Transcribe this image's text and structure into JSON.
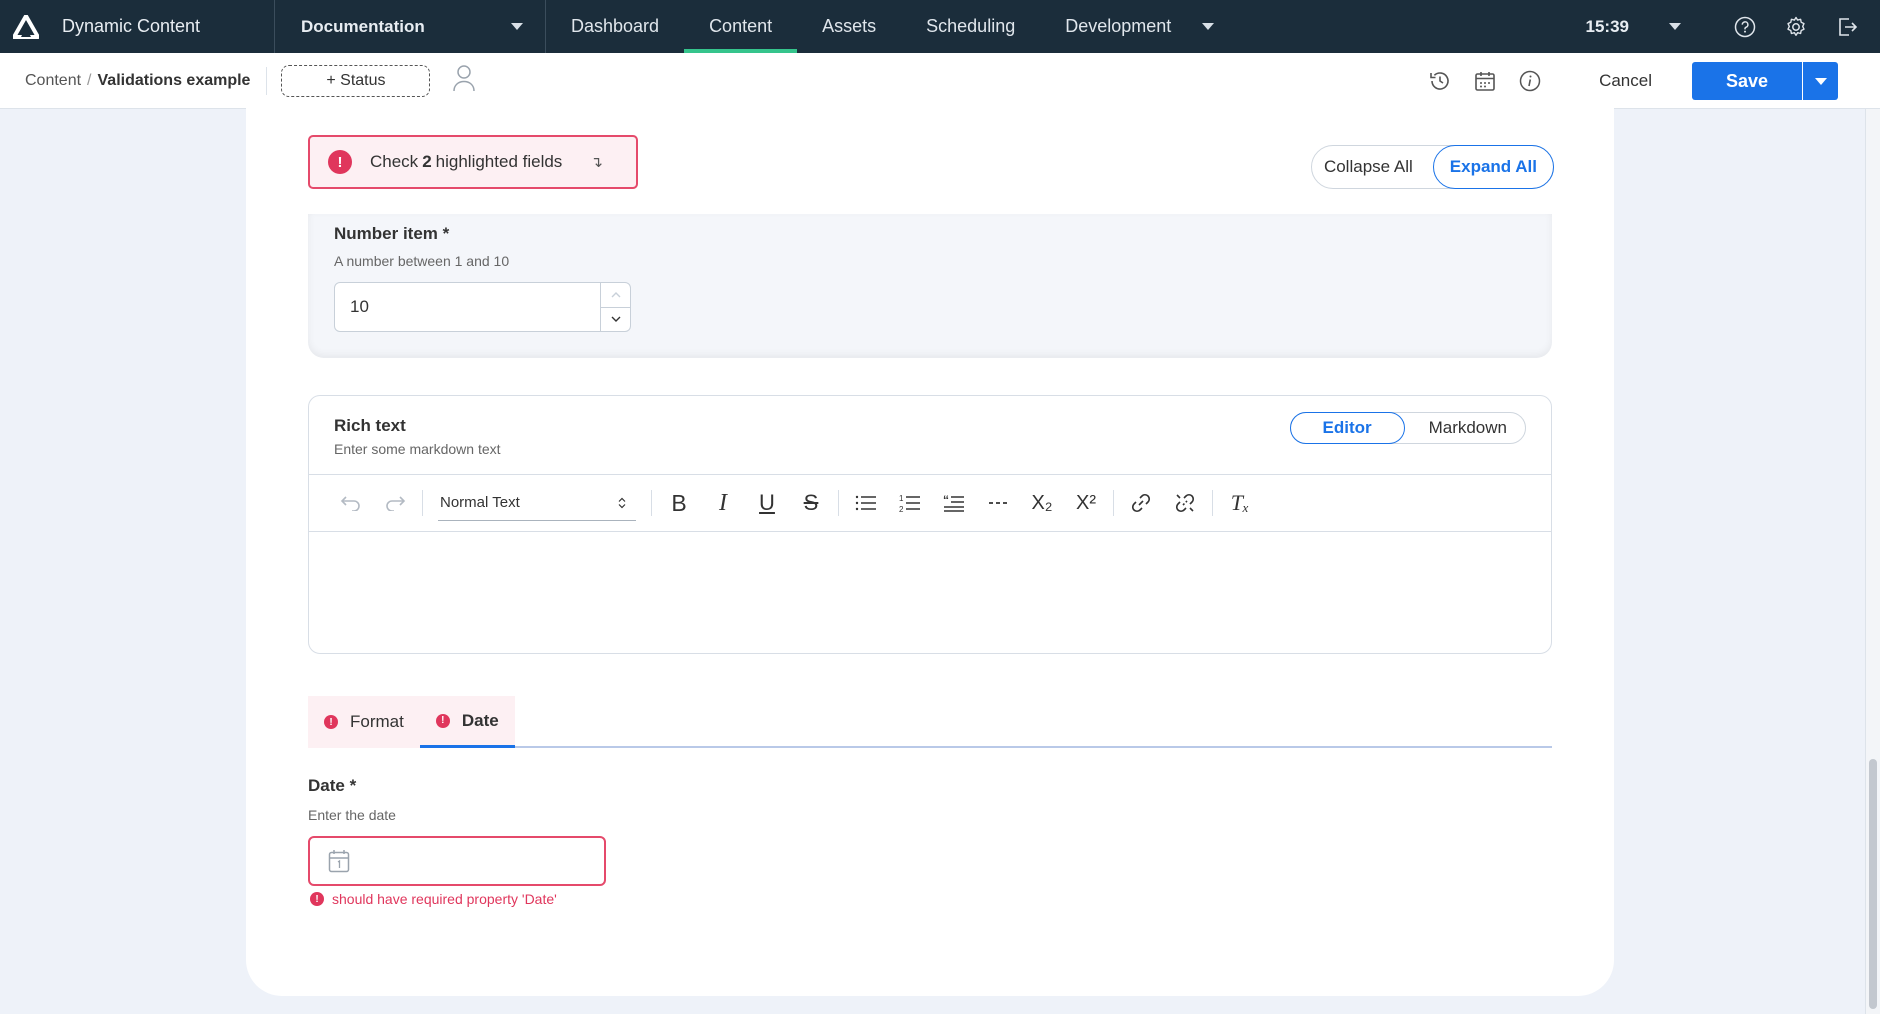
{
  "app": {
    "name": "Dynamic Content",
    "hub": "Documentation"
  },
  "nav": {
    "tabs": [
      {
        "label": "Dashboard"
      },
      {
        "label": "Content"
      },
      {
        "label": "Assets"
      },
      {
        "label": "Scheduling"
      },
      {
        "label": "Development"
      }
    ],
    "active_tab": "Content",
    "time": "15:39"
  },
  "breadcrumb": {
    "root": "Content",
    "separator": "/",
    "current": "Validations example"
  },
  "toolbar": {
    "status_label": "+ Status",
    "cancel_label": "Cancel",
    "save_label": "Save"
  },
  "alert": {
    "prefix": "Check",
    "count": "2",
    "suffix": "highlighted fields",
    "jump_glyph": "↴"
  },
  "collapse": {
    "collapse_label": "Collapse All",
    "expand_label": "Expand All"
  },
  "number_field": {
    "label": "Number item *",
    "description": "A number between 1 and 10",
    "value": "10"
  },
  "rich_text": {
    "label": "Rich text",
    "description": "Enter some markdown text",
    "mode_editor": "Editor",
    "mode_markdown": "Markdown",
    "style_select": "Normal Text",
    "buttons": {
      "bold": "B",
      "italic": "I",
      "underline": "U",
      "strike": "S",
      "subscript": "X₂",
      "superscript": "X²",
      "clear": "Tₓ"
    }
  },
  "tabs": [
    {
      "label": "Format",
      "error": true
    },
    {
      "label": "Date",
      "error": true,
      "active": true
    }
  ],
  "date_field": {
    "label": "Date *",
    "description": "Enter the date",
    "value": "",
    "error": "should have required property 'Date'"
  },
  "colors": {
    "nav_bg": "#1b2d3b",
    "active_underline": "#35c48c",
    "primary": "#1a73e8",
    "error": "#e0365c",
    "page_bg": "#eef2f9"
  },
  "icons": [
    "logo-icon",
    "caret-down-icon",
    "help-icon",
    "gear-icon",
    "logout-icon",
    "user-icon",
    "history-icon",
    "calendar-icon",
    "info-icon",
    "undo-icon",
    "redo-icon",
    "bullet-list-icon",
    "numbered-list-icon",
    "blockquote-icon",
    "horizontal-rule-icon",
    "link-icon",
    "unlink-icon",
    "error-icon"
  ]
}
